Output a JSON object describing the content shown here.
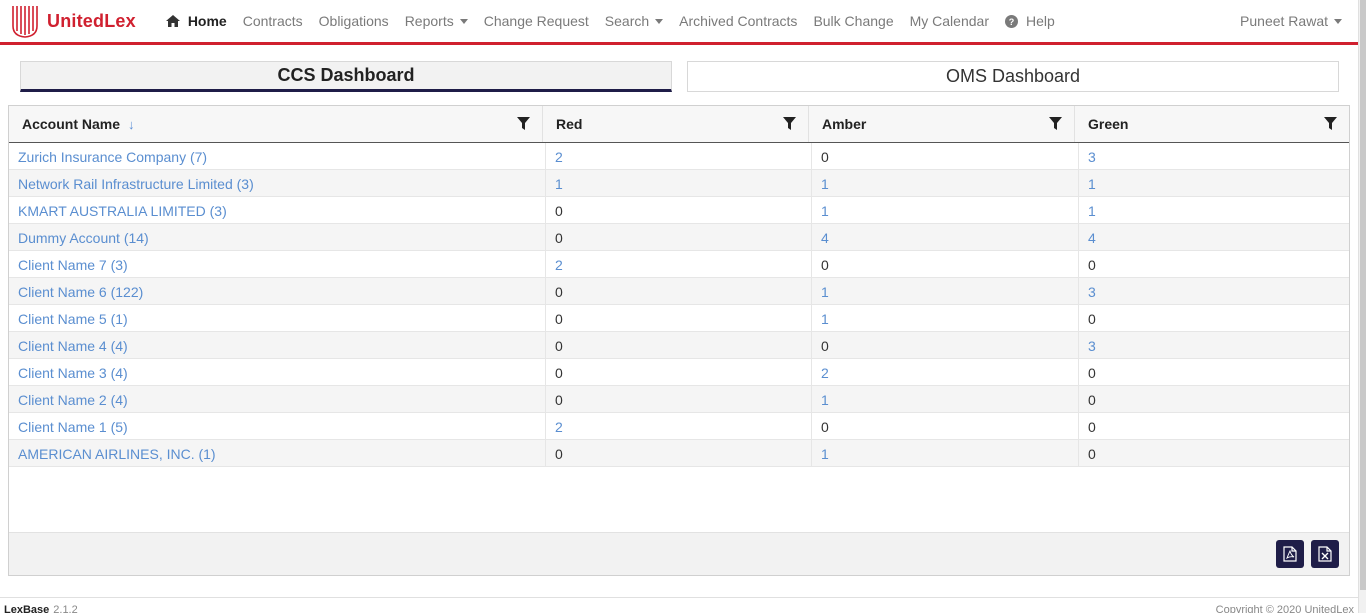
{
  "brand": {
    "name": "UnitedLex",
    "color": "#d0202f"
  },
  "nav": {
    "items": [
      {
        "label": "Home",
        "icon": "home-icon",
        "active": true
      },
      {
        "label": "Contracts"
      },
      {
        "label": "Obligations"
      },
      {
        "label": "Reports",
        "dropdown": true
      },
      {
        "label": "Change Request"
      },
      {
        "label": "Search",
        "dropdown": true
      },
      {
        "label": "Archived Contracts"
      },
      {
        "label": "Bulk Change"
      },
      {
        "label": "My Calendar"
      },
      {
        "label": "Help",
        "icon": "help-icon"
      }
    ],
    "user": "Puneet Rawat"
  },
  "tabs": {
    "ccs": "CCS Dashboard",
    "oms": "OMS Dashboard"
  },
  "grid": {
    "columns": [
      "Account Name",
      "Red",
      "Amber",
      "Green"
    ],
    "sort_indicator": "↓",
    "rows": [
      {
        "account": "Zurich Insurance Company (7)",
        "red": "2",
        "amber": "0",
        "green": "3"
      },
      {
        "account": "Network Rail Infrastructure Limited (3)",
        "red": "1",
        "amber": "1",
        "green": "1"
      },
      {
        "account": "KMART AUSTRALIA LIMITED (3)",
        "red": "0",
        "amber": "1",
        "green": "1"
      },
      {
        "account": "Dummy Account (14)",
        "red": "0",
        "amber": "4",
        "green": "4"
      },
      {
        "account": "Client Name 7 (3)",
        "red": "2",
        "amber": "0",
        "green": "0"
      },
      {
        "account": "Client Name 6 (122)",
        "red": "0",
        "amber": "1",
        "green": "3"
      },
      {
        "account": "Client Name 5 (1)",
        "red": "0",
        "amber": "1",
        "green": "0"
      },
      {
        "account": "Client Name 4 (4)",
        "red": "0",
        "amber": "0",
        "green": "3"
      },
      {
        "account": "Client Name 3 (4)",
        "red": "0",
        "amber": "2",
        "green": "0"
      },
      {
        "account": "Client Name 2 (4)",
        "red": "0",
        "amber": "1",
        "green": "0"
      },
      {
        "account": "Client Name 1 (5)",
        "red": "2",
        "amber": "0",
        "green": "0"
      },
      {
        "account": "AMERICAN AIRLINES, INC. (1)",
        "red": "0",
        "amber": "1",
        "green": "0"
      }
    ],
    "export_buttons": [
      "pdf-export-icon",
      "excel-export-icon"
    ]
  },
  "footer": {
    "product": "LexBase",
    "version": "2.1.2",
    "copyright": "Copyright © 2020 UnitedLex"
  },
  "colors": {
    "accent": "#d0202f",
    "navy": "#1f1d48",
    "link": "#5a8ed0"
  }
}
